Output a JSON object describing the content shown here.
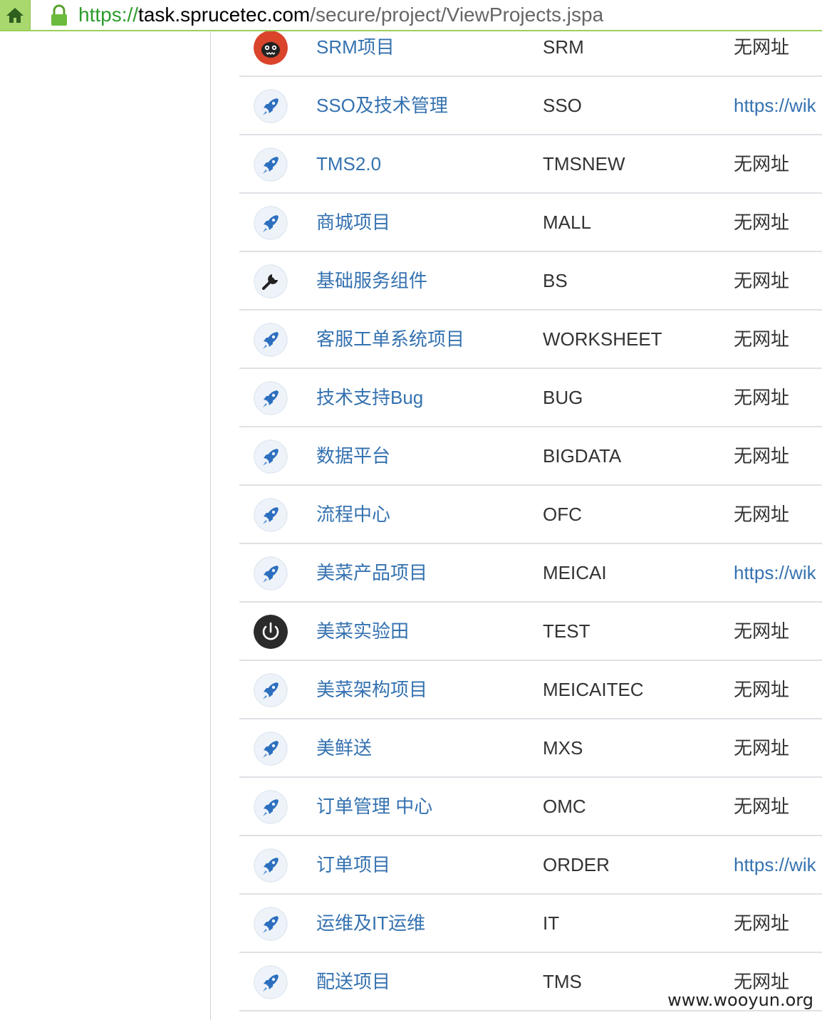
{
  "browser": {
    "url_scheme": "https://",
    "url_host": "task.sprucetec.com",
    "url_path": "/secure/project/ViewProjects.jspa"
  },
  "projects": [
    {
      "name": "SRM项目",
      "key": "SRM",
      "url": "无网址",
      "url_is_link": false,
      "avatar": "monster-avatar-icon"
    },
    {
      "name": "SSO及技术管理",
      "key": "SSO",
      "url": "https://wik",
      "url_is_link": true,
      "avatar": "rocket-icon"
    },
    {
      "name": "TMS2.0",
      "key": "TMSNEW",
      "url": "无网址",
      "url_is_link": false,
      "avatar": "rocket-icon"
    },
    {
      "name": "商城项目",
      "key": "MALL",
      "url": "无网址",
      "url_is_link": false,
      "avatar": "rocket-icon"
    },
    {
      "name": "基础服务组件",
      "key": "BS",
      "url": "无网址",
      "url_is_link": false,
      "avatar": "wrench-icon"
    },
    {
      "name": "客服工单系统项目",
      "key": "WORKSHEET",
      "url": "无网址",
      "url_is_link": false,
      "avatar": "rocket-icon"
    },
    {
      "name": "技术支持Bug",
      "key": "BUG",
      "url": "无网址",
      "url_is_link": false,
      "avatar": "rocket-icon"
    },
    {
      "name": "数据平台",
      "key": "BIGDATA",
      "url": "无网址",
      "url_is_link": false,
      "avatar": "rocket-icon"
    },
    {
      "name": "流程中心",
      "key": "OFC",
      "url": "无网址",
      "url_is_link": false,
      "avatar": "rocket-icon"
    },
    {
      "name": "美菜产品项目",
      "key": "MEICAI",
      "url": "https://wik",
      "url_is_link": true,
      "avatar": "rocket-icon"
    },
    {
      "name": "美菜实验田",
      "key": "TEST",
      "url": "无网址",
      "url_is_link": false,
      "avatar": "power-icon"
    },
    {
      "name": "美菜架构项目",
      "key": "MEICAITEC",
      "url": "无网址",
      "url_is_link": false,
      "avatar": "rocket-icon"
    },
    {
      "name": "美鲜送",
      "key": "MXS",
      "url": "无网址",
      "url_is_link": false,
      "avatar": "rocket-icon"
    },
    {
      "name": "订单管理 中心",
      "key": "OMC",
      "url": "无网址",
      "url_is_link": false,
      "avatar": "rocket-icon"
    },
    {
      "name": "订单项目",
      "key": "ORDER",
      "url": "https://wik",
      "url_is_link": true,
      "avatar": "rocket-icon"
    },
    {
      "name": "运维及IT运维",
      "key": "IT",
      "url": "无网址",
      "url_is_link": false,
      "avatar": "rocket-icon"
    },
    {
      "name": "配送项目",
      "key": "TMS",
      "url": "无网址",
      "url_is_link": false,
      "avatar": "rocket-icon"
    }
  ],
  "watermark": "www.wooyun.org",
  "colors": {
    "link": "#3572b0",
    "text": "#333333",
    "row_border": "#dfe1e5",
    "urlbar_accent": "#9bd05a"
  }
}
